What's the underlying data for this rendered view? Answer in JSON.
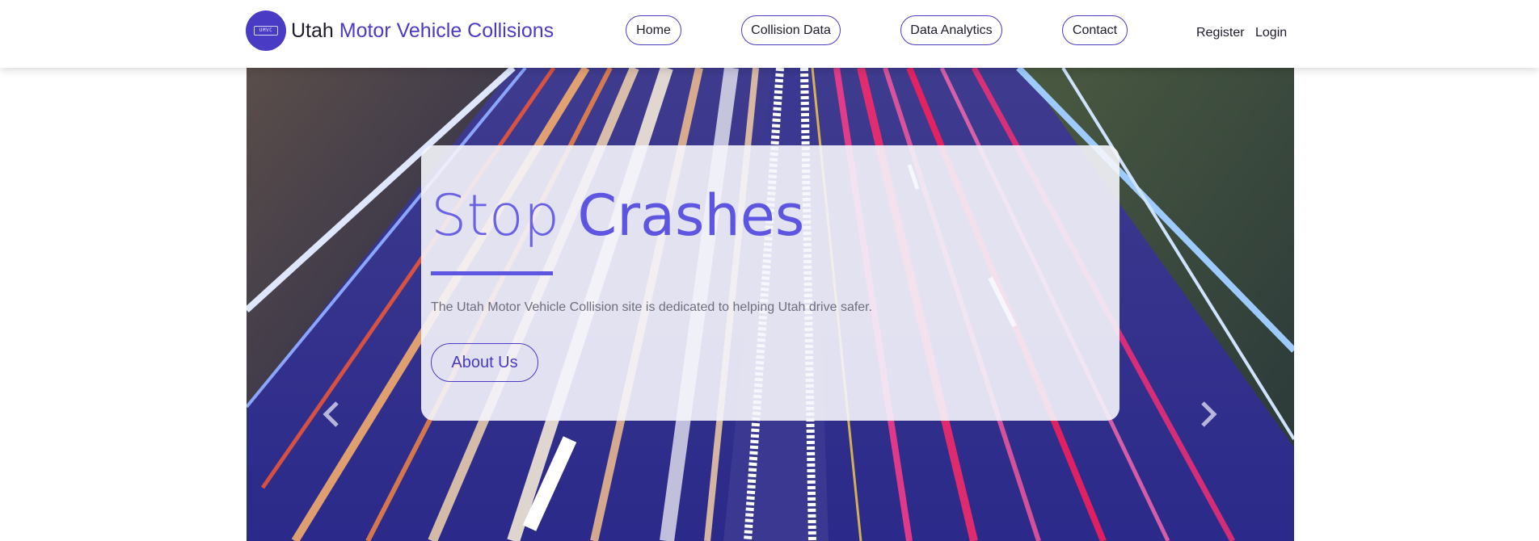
{
  "brand": {
    "logo_text": "UMVC",
    "name_first": "Utah",
    "name_rest": " Motor Vehicle Collisions"
  },
  "nav": {
    "items": [
      {
        "label": "Home"
      },
      {
        "label": "Collision Data"
      },
      {
        "label": "Data Analytics"
      },
      {
        "label": "Contact"
      }
    ],
    "register_label": "Register",
    "login_label": "Login"
  },
  "hero": {
    "title_part1": "Stop ",
    "title_part2": "Crashes",
    "description": "The Utah Motor Vehicle Collision site is dedicated to helping Utah drive safer.",
    "button_label": "About Us"
  },
  "colors": {
    "accent": "#4a3bc4",
    "title": "#5e56e0",
    "text": "#1c1c2b"
  },
  "icons": {
    "prev": "chevron-left-icon",
    "next": "chevron-right-icon"
  }
}
